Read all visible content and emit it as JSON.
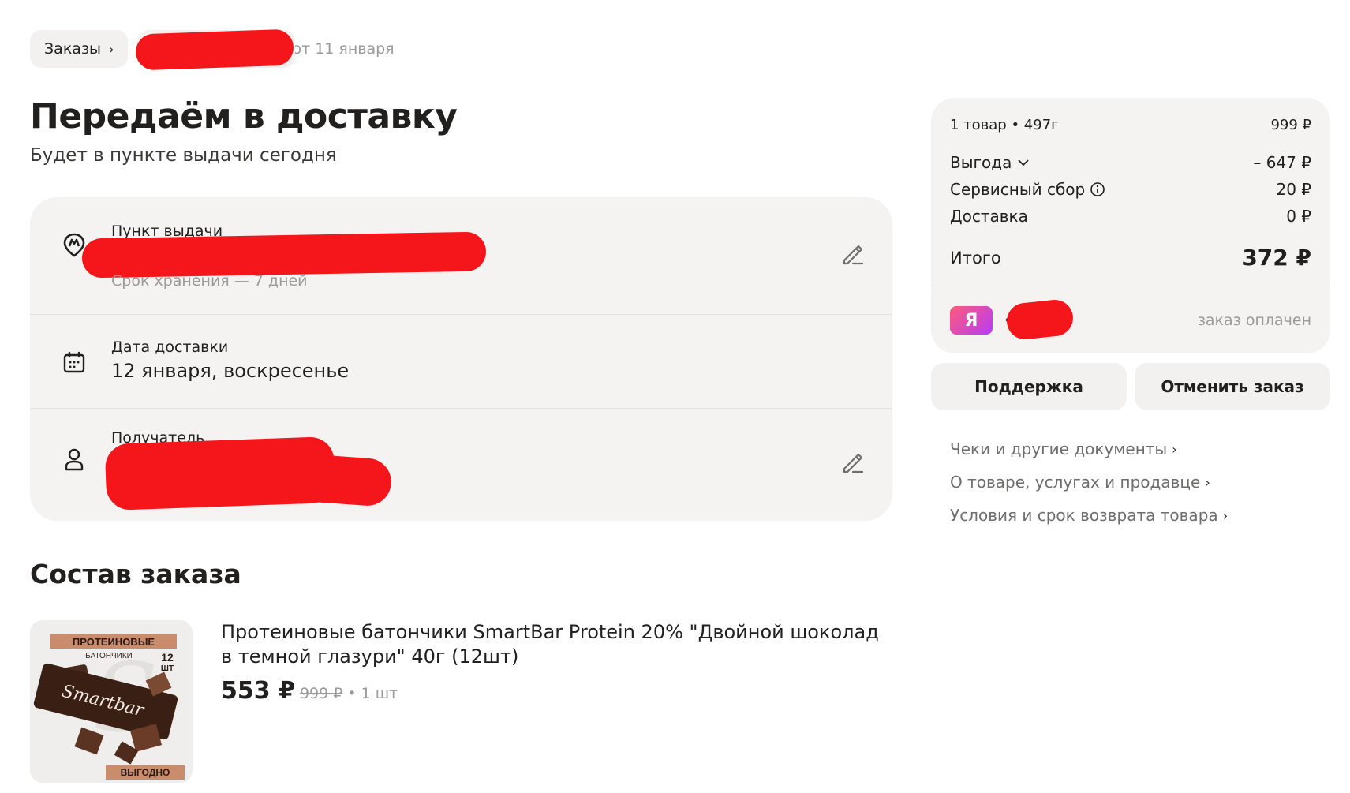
{
  "breadcrumbs": {
    "orders_label": "Заказы",
    "chevron": "›",
    "order_date": "от 11 января"
  },
  "header": {
    "title": "Передаём в доставку",
    "subtitle": "Будет в пункте выдачи сегодня"
  },
  "delivery": {
    "pickup": {
      "label": "Пункт выдачи",
      "hint": "Срок хранения — 7 дней",
      "icon": "market-pin-icon"
    },
    "date": {
      "label": "Дата доставки",
      "value": "12 января, воскресенье",
      "icon": "calendar-icon"
    },
    "recipient": {
      "label": "Получатель",
      "icon": "person-icon"
    }
  },
  "composition": {
    "title": "Состав заказа",
    "items": [
      {
        "name": "Протеиновые батончики SmartBar Protein 20% \"Двойной шоколад в темной глазури\" 40г (12шт)",
        "price": "553 ₽",
        "old_price": "999 ₽",
        "quantity": "• 1 шт",
        "image_texts": {
          "top": "ПРОТЕИНОВЫЕ",
          "top2": "БАТОНЧИКИ",
          "count": "12",
          "count_unit": "ШТ",
          "brand": "Smartbar",
          "bottom": "ВЫГОДНО"
        }
      }
    ]
  },
  "summary": {
    "goods": {
      "label": "1 товар • 497г",
      "value": "999 ₽"
    },
    "benefit": {
      "label": "Выгода",
      "value": "– 647 ₽"
    },
    "service_fee": {
      "label": "Сервисный сбор",
      "value": "20 ₽"
    },
    "delivery": {
      "label": "Доставка",
      "value": "0 ₽"
    },
    "total": {
      "label": "Итого",
      "value": "372 ₽"
    },
    "payment": {
      "badge": "Я",
      "dots": "••",
      "status": "заказ оплачен"
    }
  },
  "actions": {
    "support": "Поддержка",
    "cancel": "Отменить заказ"
  },
  "links": [
    "Чеки и другие документы",
    "О товаре, услугах и продавце",
    "Условия и срок возврата товара"
  ],
  "colors": {
    "card_bg": "#f4f3f1",
    "redaction": "#f4161a",
    "muted_text": "#9b9a98"
  }
}
